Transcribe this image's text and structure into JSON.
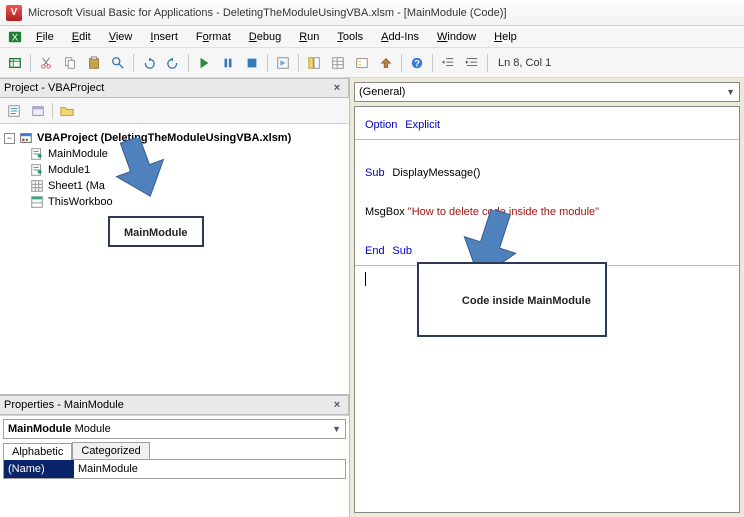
{
  "title": "Microsoft Visual Basic for Applications - DeletingTheModuleUsingVBA.xlsm - [MainModule (Code)]",
  "menus": {
    "file": "File",
    "edit": "Edit",
    "view": "View",
    "insert": "Insert",
    "format": "Format",
    "debug": "Debug",
    "run": "Run",
    "tools": "Tools",
    "addins": "Add-Ins",
    "window": "Window",
    "help": "Help"
  },
  "cursor_pos": "Ln 8, Col 1",
  "project_panel_title": "Project - VBAProject",
  "tree": {
    "root": "VBAProject (DeletingTheModuleUsingVBA.xlsm)",
    "items": [
      "MainModule",
      "Module1",
      "Sheet1 (Ma",
      "ThisWorkboo"
    ]
  },
  "props_panel_title": "Properties - MainModule",
  "props_combo_name": "MainModule",
  "props_combo_type": "Module",
  "props_tabs": {
    "alpha": "Alphabetic",
    "cat": "Categorized"
  },
  "props_row": {
    "name": "(Name)",
    "value": "MainModule"
  },
  "object_combo": "(General)",
  "code": {
    "l1a": "Option",
    "l1b": "Explicit",
    "l2a": "Sub",
    "l2b": "DisplayMessage()",
    "l3a": "MsgBox ",
    "l3b": "\"How to delete code inside the module\"",
    "l4a": "End",
    "l4b": "Sub"
  },
  "callouts": {
    "left": "MainModule",
    "right": "Code inside MainModule"
  }
}
